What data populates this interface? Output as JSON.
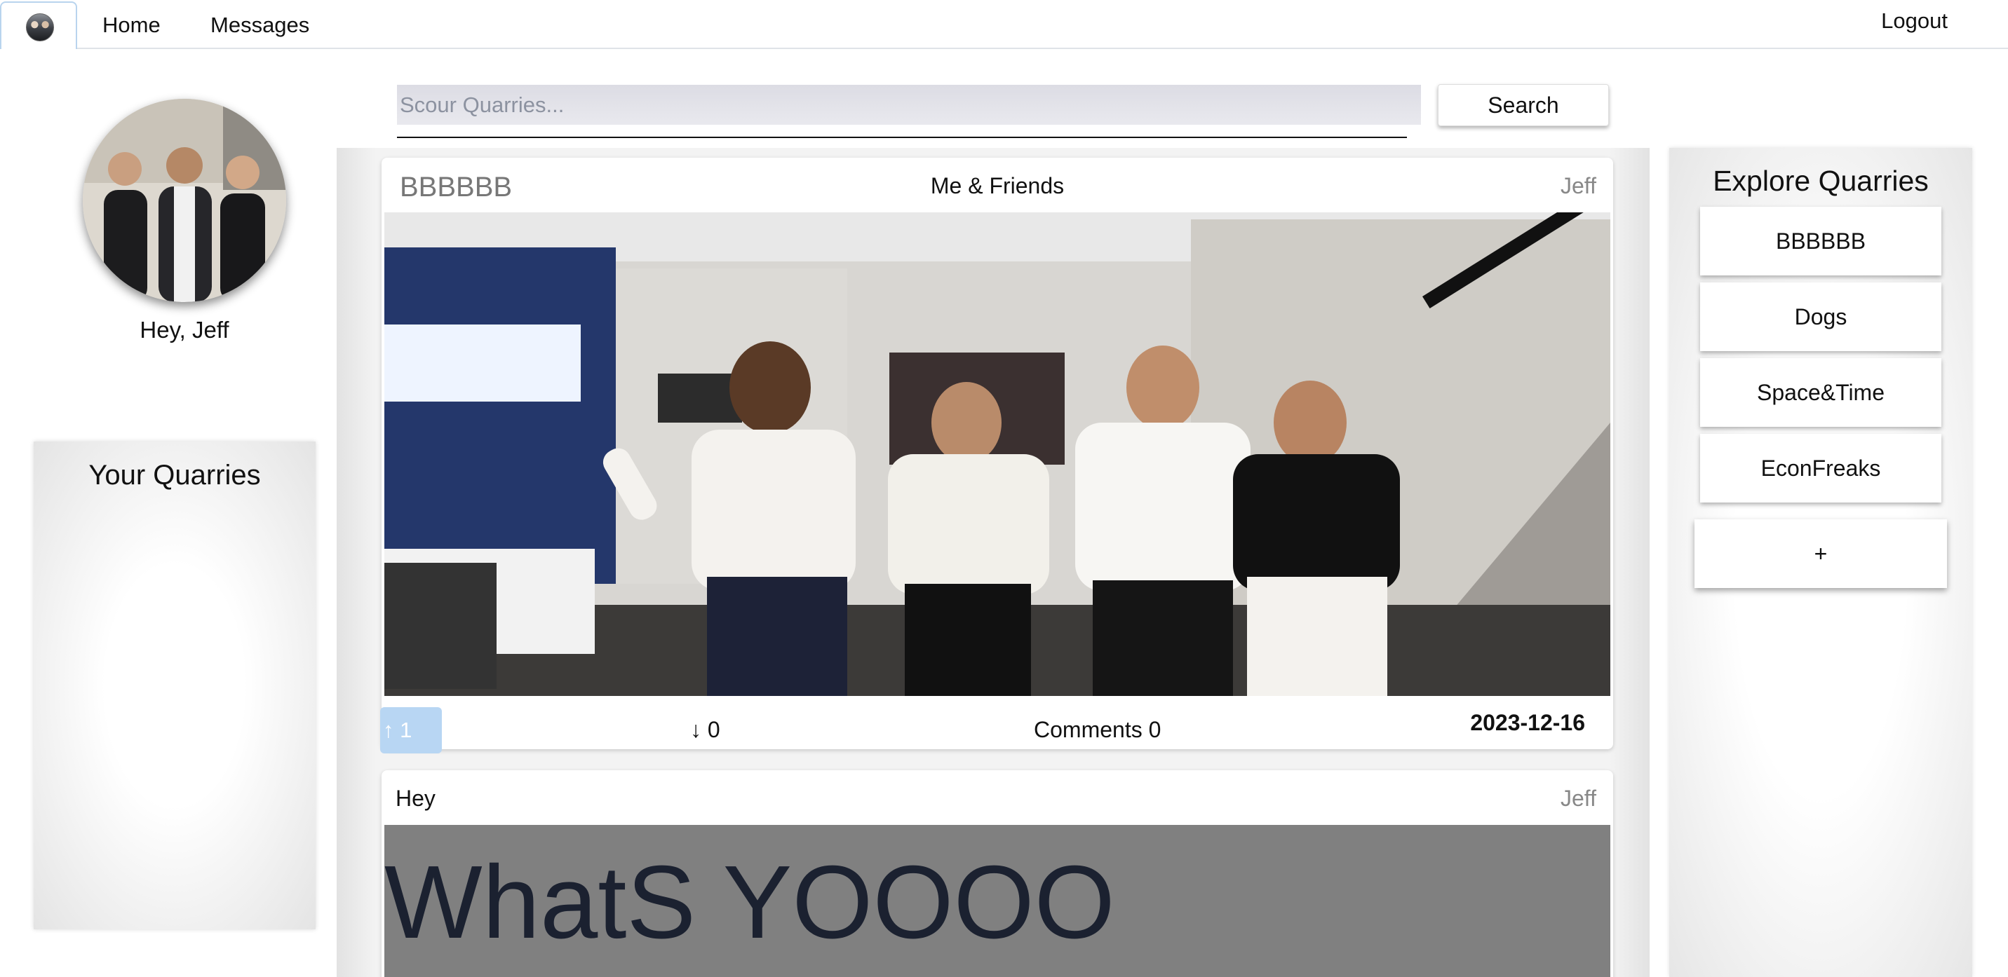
{
  "nav": {
    "home": "Home",
    "messages": "Messages",
    "logout": "Logout"
  },
  "profile": {
    "greeting": "Hey, Jeff"
  },
  "your_quarries": {
    "title": "Your Quarries"
  },
  "search": {
    "placeholder": "Scour Quarries...",
    "button": "Search"
  },
  "posts": [
    {
      "quarry": "BBBBBB",
      "title": "Me & Friends",
      "author": "Jeff",
      "upvotes": "↑ 1",
      "downvotes": "↓ 0",
      "comments": "Comments 0",
      "date": "2023-12-16"
    },
    {
      "title": "Hey",
      "author": "Jeff",
      "body": "WhatS YOOOO"
    }
  ],
  "explore": {
    "title": "Explore Quarries",
    "items": [
      "BBBBBB",
      "Dogs",
      "Space&Time",
      "EconFreaks"
    ],
    "add": "+"
  },
  "colors": {
    "upvote_bg": "#b8d6f3",
    "text_post_bg": "#808080",
    "search_bg": "#dcdce4"
  }
}
